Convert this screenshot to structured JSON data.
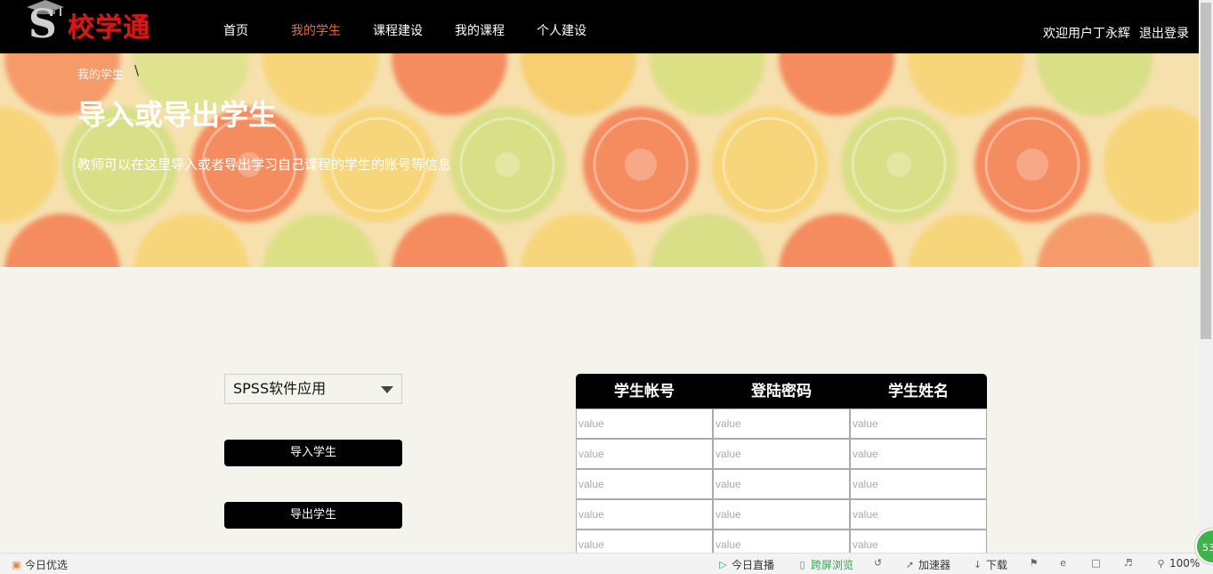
{
  "nav": {
    "logo_text": "校学通",
    "items": [
      {
        "label": "首页",
        "active": false
      },
      {
        "label": "我的学生",
        "active": true
      },
      {
        "label": "课程建设",
        "active": false
      },
      {
        "label": "我的课程",
        "active": false
      },
      {
        "label": "个人建设",
        "active": false
      }
    ],
    "welcome": "欢迎用户丁永辉",
    "logout": "退出登录"
  },
  "banner": {
    "breadcrumb": "我的学生",
    "breadcrumb_sep": "\\",
    "title": "导入或导出学生",
    "description": "教师可以在这里导入或者导出学习自己课程的学生的账号等信息"
  },
  "controls": {
    "course_selected": "SPSS软件应用",
    "import_label": "导入学生",
    "export_label": "导出学生"
  },
  "table": {
    "headers": [
      "学生帐号",
      "登陆密码",
      "学生姓名"
    ],
    "rows": [
      [
        "value",
        "value",
        "value"
      ],
      [
        "value",
        "value",
        "value"
      ],
      [
        "value",
        "value",
        "value"
      ],
      [
        "value",
        "value",
        "value"
      ],
      [
        "value",
        "value",
        "value"
      ]
    ]
  },
  "statusbar": {
    "today_pick": "今日优选",
    "live": "今日直播",
    "cross_screen": "跨屏浏览",
    "accelerator": "加速器",
    "download": "下载",
    "zoom": "100%",
    "badge": "53"
  },
  "colors": {
    "accent": "#f0653a",
    "nav_bg": "#000000",
    "page_bg": "#f5f4ec"
  }
}
